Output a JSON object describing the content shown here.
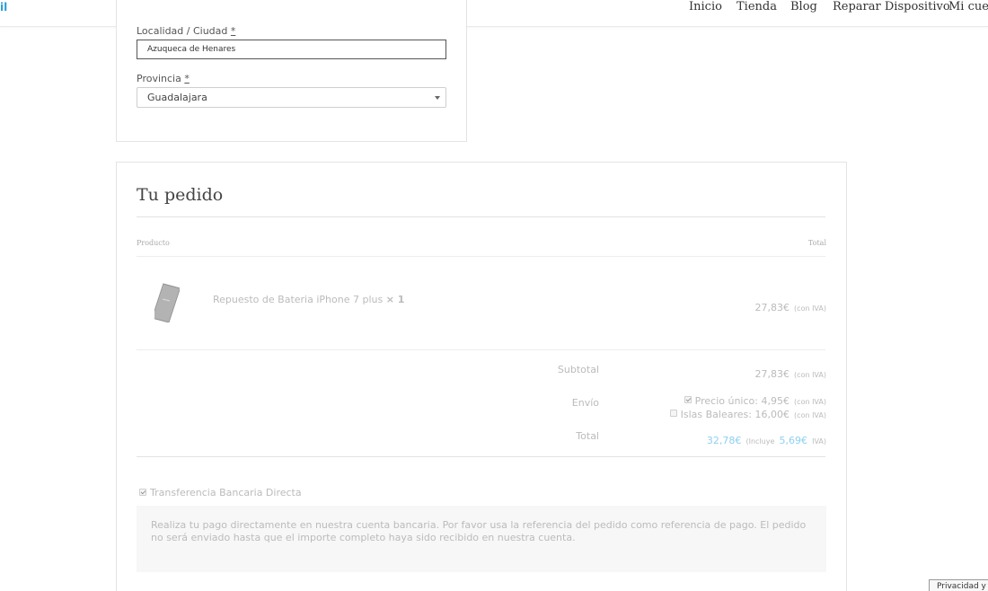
{
  "logo_fragment": "il",
  "nav": {
    "items": [
      "Inicio",
      "Tienda",
      "Blog",
      "Reparar Dispositivo",
      "Mi cuenta"
    ]
  },
  "address": {
    "city_label": "Localidad / Ciudad",
    "city_required": "*",
    "city_value": "Azuqueca de Henares",
    "province_label": "Provincia",
    "province_required": "*",
    "province_value": "Guadalajara"
  },
  "order": {
    "heading": "Tu pedido",
    "col_product": "Producto",
    "col_total": "Total",
    "item": {
      "name": "Repuesto de Bateria iPhone 7 plus",
      "qty": "× 1",
      "price": "27,83€",
      "tax_note": "(con IVA)"
    },
    "subtotal_label": "Subtotal",
    "subtotal_value": "27,83€",
    "subtotal_note": "(con IVA)",
    "shipping_label": "Envío",
    "shipping_options": [
      {
        "label": "Precio único: 4,95€",
        "note": "(con IVA)",
        "checked": true
      },
      {
        "label": "Islas Baleares: 16,00€",
        "note": "(con IVA)",
        "checked": false
      }
    ],
    "total_label": "Total",
    "total_value": "32,78€",
    "total_includes": "(Incluye",
    "total_tax": "5,69€",
    "total_tax_suffix": "IVA)"
  },
  "payment": {
    "method_label": "Transferencia Bancaria Directa",
    "description": "Realiza tu pago directamente en nuestra cuenta bancaria. Por favor usa la referencia del pedido como referencia de pago. El pedido no será enviado hasta que el importe completo haya sido recibido en nuestra cuenta."
  },
  "privacy_badge": "Privacidad y L",
  "colors": {
    "accent_blue": "#8ed0f2",
    "logo_blue": "#2a9fd6",
    "muted_text": "#bbbbbb"
  }
}
